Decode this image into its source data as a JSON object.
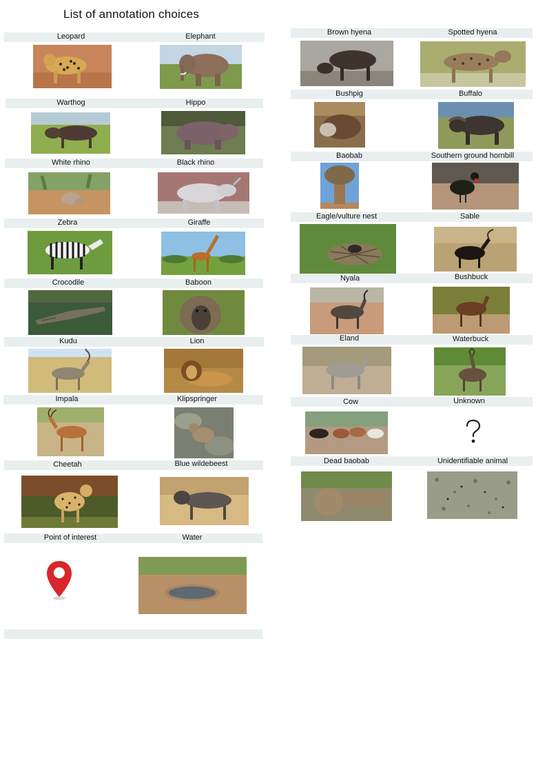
{
  "page": {
    "title": "List of annotation choices"
  },
  "left_column": [
    {
      "label": "Leopard",
      "icon": "leopard-photo"
    },
    {
      "label": "Elephant",
      "icon": "elephant-photo"
    },
    {
      "label": "Warthog",
      "icon": "warthog-photo"
    },
    {
      "label": "Hippo",
      "icon": "hippo-photo"
    },
    {
      "label": "White rhino",
      "icon": "white-rhino-photo"
    },
    {
      "label": "Black rhino",
      "icon": "black-rhino-photo"
    },
    {
      "label": "Zebra",
      "icon": "zebra-photo"
    },
    {
      "label": "Giraffe",
      "icon": "giraffe-photo"
    },
    {
      "label": "Crocodile",
      "icon": "crocodile-photo"
    },
    {
      "label": "Baboon",
      "icon": "baboon-photo"
    },
    {
      "label": "Kudu",
      "icon": "kudu-photo"
    },
    {
      "label": "Lion",
      "icon": "lion-photo"
    },
    {
      "label": "Impala",
      "icon": "impala-photo"
    },
    {
      "label": "Klipspringer",
      "icon": "klipspringer-photo"
    },
    {
      "label": "Cheetah",
      "icon": "cheetah-photo"
    },
    {
      "label": "Blue wildebeest",
      "icon": "blue-wildebeest-photo"
    },
    {
      "label": "Point of interest",
      "icon": "map-pin-icon"
    },
    {
      "label": "Water",
      "icon": "waterhole-photo"
    }
  ],
  "right_column": [
    {
      "label": "Brown hyena",
      "icon": "brown-hyena-photo"
    },
    {
      "label": "Spotted hyena",
      "icon": "spotted-hyena-photo"
    },
    {
      "label": "Bushpig",
      "icon": "bushpig-photo"
    },
    {
      "label": "Buffalo",
      "icon": "buffalo-photo"
    },
    {
      "label": "Baobab",
      "icon": "baobab-photo"
    },
    {
      "label": "Southern ground hornbill",
      "icon": "hornbill-photo"
    },
    {
      "label": "Eagle/vulture nest",
      "icon": "nest-photo"
    },
    {
      "label": "Sable",
      "icon": "sable-photo"
    },
    {
      "label": "Nyala",
      "icon": "nyala-photo"
    },
    {
      "label": "Bushbuck",
      "icon": "bushbuck-photo"
    },
    {
      "label": "Eland",
      "icon": "eland-photo"
    },
    {
      "label": "Waterbuck",
      "icon": "waterbuck-photo"
    },
    {
      "label": "Cow",
      "icon": "cow-photo"
    },
    {
      "label": "Unknown",
      "icon": "question-mark-icon"
    },
    {
      "label": "Dead baobab",
      "icon": "dead-baobab-photo"
    },
    {
      "label": "Unidentifiable animal",
      "icon": "aerial-texture-photo"
    }
  ],
  "colors": {
    "label_band": "#e9efef",
    "background": "#ffffff",
    "pin": "#d8262c"
  }
}
